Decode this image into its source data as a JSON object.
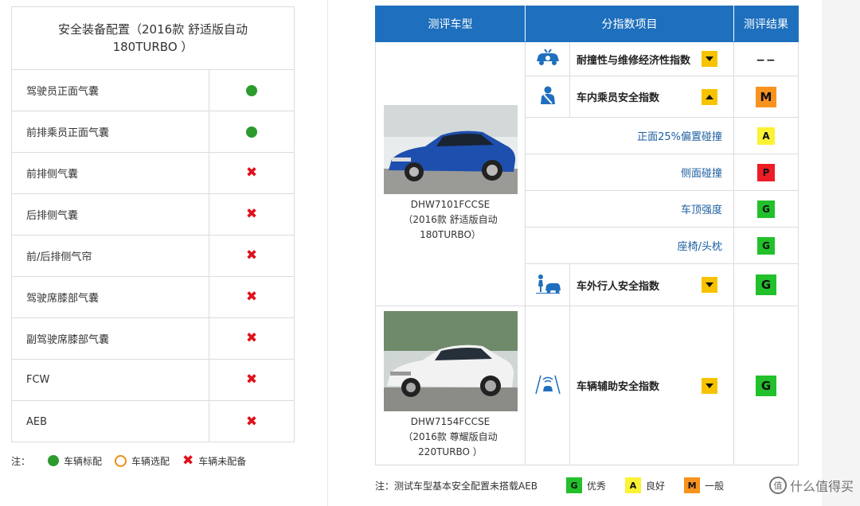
{
  "left_table": {
    "title_line1": "安全装备配置（2016款 舒适版自动",
    "title_line2": "180TURBO ）",
    "rows": [
      {
        "name": "驾驶员正面气囊",
        "status": "standard"
      },
      {
        "name": "前排乘员正面气囊",
        "status": "standard"
      },
      {
        "name": "前排侧气囊",
        "status": "none"
      },
      {
        "name": "后排侧气囊",
        "status": "none"
      },
      {
        "name": "前/后排侧气帘",
        "status": "none"
      },
      {
        "name": "驾驶席膝部气囊",
        "status": "none"
      },
      {
        "name": "副驾驶席膝部气囊",
        "status": "none"
      },
      {
        "name": "FCW",
        "status": "none"
      },
      {
        "name": "AEB",
        "status": "none"
      }
    ]
  },
  "legend": {
    "label": "注：",
    "standard": "车辆标配",
    "optional": "车辆选配",
    "none": "车辆未配备",
    "colors": {
      "standard": "#2c9a2c",
      "optional": "#f08c1a",
      "none": "#e0101a"
    }
  },
  "rating_table": {
    "headers": {
      "model": "测评车型",
      "index": "分指数项目",
      "result": "测评结果"
    },
    "car1": {
      "line1": "DHW7101FCCSE",
      "line2": "（2016款 舒适版自动",
      "line3": "180TURBO）"
    },
    "car2": {
      "line1": "DHW7154FCCSE",
      "line2": "（2016款 尊耀版自动",
      "line3": "220TURBO ）"
    },
    "idx_repair": {
      "label": "耐撞性与维修经济性指数",
      "arrow": "down",
      "result": "−−",
      "icon": "car-repair-icon"
    },
    "idx_occupant": {
      "label": "车内乘员安全指数",
      "arrow": "up",
      "result": "M",
      "icon": "seatbelt-occupant-icon"
    },
    "sub_items": [
      {
        "label": "正面25%偏置碰撞",
        "result": "A"
      },
      {
        "label": "侧面碰撞",
        "result": "P"
      },
      {
        "label": "车顶强度",
        "result": "G"
      },
      {
        "label": "座椅/头枕",
        "result": "G"
      }
    ],
    "idx_pedestrian": {
      "label": "车外行人安全指数",
      "arrow": "down",
      "result": "G",
      "icon": "pedestrian-car-icon"
    },
    "idx_assist": {
      "label": "车辆辅助安全指数",
      "arrow": "down",
      "result": "G",
      "icon": "driver-assist-icon"
    },
    "colors": {
      "header": "#1e6fbd",
      "G": "#22c02a",
      "A": "#fbf235",
      "M": "#f7931e",
      "P": "#ee1c25",
      "arrow": "#f7c300"
    }
  },
  "note": {
    "text": "注：测试车型基本安全配置未搭载AEB",
    "items": [
      {
        "grade": "G",
        "label": "优秀"
      },
      {
        "grade": "A",
        "label": "良好"
      },
      {
        "grade": "M",
        "label": "一般"
      }
    ]
  },
  "watermark": {
    "text": "什么值得买"
  }
}
